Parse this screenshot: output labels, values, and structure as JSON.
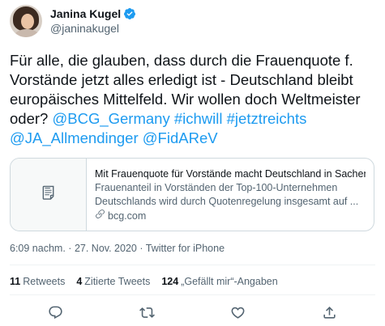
{
  "author": {
    "display_name": "Janina Kugel",
    "handle": "@janinakugel",
    "verified": true
  },
  "tweet": {
    "text_plain_1": "Für alle, die glauben, dass durch die Frauenquote f. Vorstände jetzt alles erledigt ist - Deutschland bleibt europäisches Mittelfeld. Wir wollen doch Weltmeister oder? ",
    "mention_1": "@BCG_Germany",
    "hashtag_1": "#ichwill",
    "hashtag_2": "#jetztreichts",
    "mention_2": "@JA_Allmendinger",
    "mention_3": "@FidAReV"
  },
  "card": {
    "icon": "article-icon",
    "title": "Mit Frauenquote für Vorstände macht Deutschland in Sachen ...",
    "description": "Frauenanteil in Vorständen der Top-100-Unternehmen Deutschlands wird durch Quotenregelung insgesamt auf ...",
    "domain": "bcg.com"
  },
  "meta": {
    "time": "6:09 nachm.",
    "separator": "·",
    "date": "27. Nov. 2020",
    "source": "Twitter for iPhone"
  },
  "stats": {
    "retweets_count": "11",
    "retweets_label": "Retweets",
    "quotes_count": "4",
    "quotes_label": "Zitierte Tweets",
    "likes_count": "124",
    "likes_label": "„Gefällt mir“-Angaben"
  },
  "actions": [
    "reply-icon",
    "retweet-icon",
    "like-icon",
    "share-icon"
  ],
  "colors": {
    "link": "#1d9bf0",
    "text": "#0f1419",
    "secondary": "#536471",
    "border": "#cfd9de"
  }
}
